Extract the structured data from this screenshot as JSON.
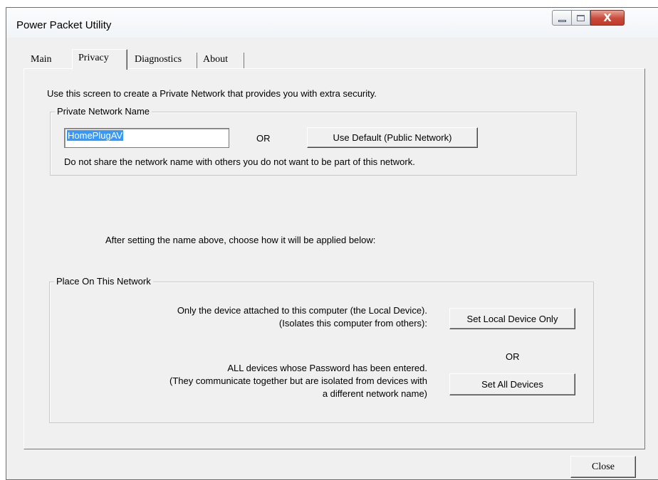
{
  "window": {
    "title": "Power Packet Utility",
    "minimize_icon": "minimize-icon",
    "maximize_icon": "maximize-icon",
    "close_icon": "close-icon",
    "close_glyph": "X"
  },
  "tabs": [
    {
      "label": "Main",
      "active": false
    },
    {
      "label": "Privacy",
      "active": true
    },
    {
      "label": "Diagnostics",
      "active": false
    },
    {
      "label": "About",
      "active": false
    }
  ],
  "privacy": {
    "intro": "Use this screen to create a Private Network that provides you with extra security.",
    "network_group": {
      "legend": "Private Network Name",
      "name_value": "HomePlugAV",
      "or_label": "OR",
      "default_button": "Use Default (Public Network)",
      "warning": "Do not share the network name with others you do not want to be part of this network."
    },
    "after_text": "After setting the name above, choose how it will be applied below:",
    "place_group": {
      "legend": "Place On This Network",
      "local_line1": "Only the device attached to this computer (the Local Device).",
      "local_line2": "(Isolates this computer from others):",
      "local_button": "Set Local Device Only",
      "or_label": "OR",
      "all_line1": "ALL devices whose Password has been entered.",
      "all_line2": "(They communicate together but are isolated from devices with",
      "all_line3": "a different network name)",
      "all_button": "Set All Devices"
    }
  },
  "footer": {
    "close_button": "Close"
  }
}
